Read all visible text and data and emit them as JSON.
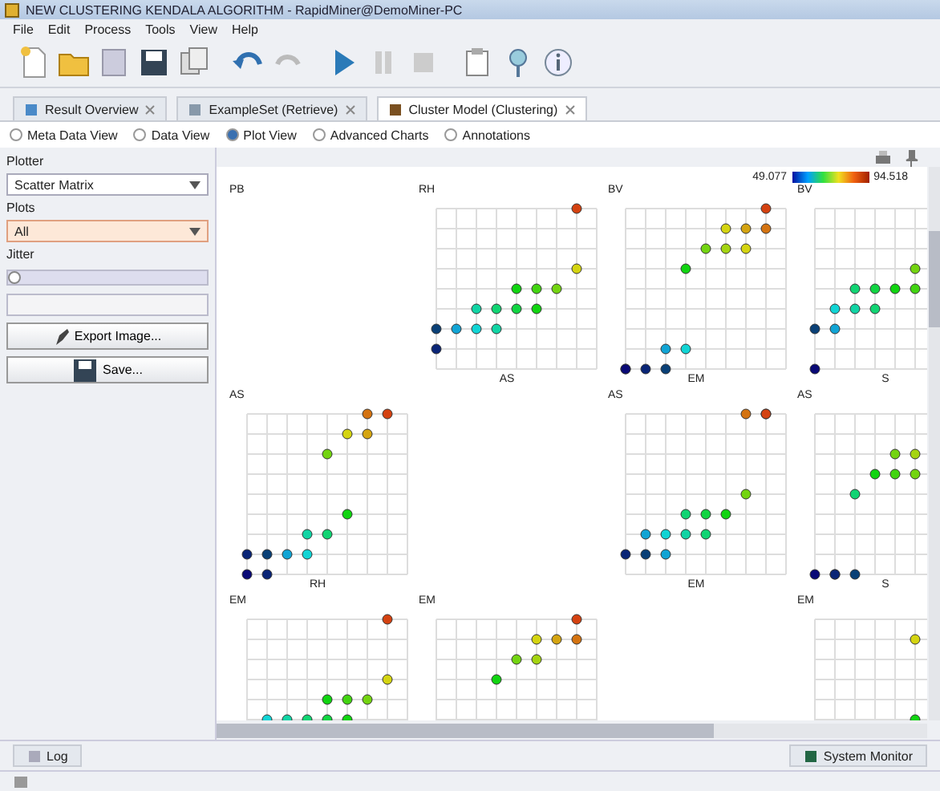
{
  "window": {
    "title": "NEW CLUSTERING KENDALA ALGORITHM - RapidMiner@DemoMiner-PC"
  },
  "menu": [
    "File",
    "Edit",
    "Process",
    "Tools",
    "View",
    "Help"
  ],
  "tabs": [
    {
      "label": "Result Overview",
      "selected": false
    },
    {
      "label": "ExampleSet (Retrieve)",
      "selected": false
    },
    {
      "label": "Cluster Model (Clustering)",
      "selected": true
    }
  ],
  "views": [
    {
      "label": "Meta Data View",
      "selected": false
    },
    {
      "label": "Data View",
      "selected": false
    },
    {
      "label": "Plot View",
      "selected": true
    },
    {
      "label": "Advanced Charts",
      "selected": false
    },
    {
      "label": "Annotations",
      "selected": false
    }
  ],
  "sidebar": {
    "plotter_label": "Plotter",
    "plotter": "Scatter Matrix",
    "plots_label": "Plots",
    "plots": "All",
    "jitter_label": "Jitter",
    "jitter": {
      "level": 0
    },
    "export_button": "Export Image...",
    "save_button": "Save..."
  },
  "legend": {
    "min": "49.077",
    "max": "94.518"
  },
  "panels": [
    {
      "kind": "diagonal",
      "title": "PB"
    },
    {
      "kind": "plot",
      "title": "RH",
      "xlabel": "AS"
    },
    {
      "kind": "plot",
      "title": "BV",
      "xlabel": "EM"
    },
    {
      "kind": "plot",
      "title": "BV",
      "xlabel": "S"
    },
    {
      "kind": "plot",
      "title": "AS",
      "xlabel": "RH"
    },
    {
      "kind": "diagonal"
    },
    {
      "kind": "plot",
      "title": "AS",
      "xlabel": "EM"
    },
    {
      "kind": "plot",
      "title": "AS",
      "xlabel": "S"
    },
    {
      "kind": "plot",
      "title": "EM"
    },
    {
      "kind": "plot",
      "title": "EM"
    },
    {
      "kind": "diagonal"
    },
    {
      "kind": "plot",
      "title": "EM"
    }
  ],
  "bottom_tabs": [
    {
      "label": "Log"
    },
    {
      "label": "System Monitor"
    }
  ]
}
